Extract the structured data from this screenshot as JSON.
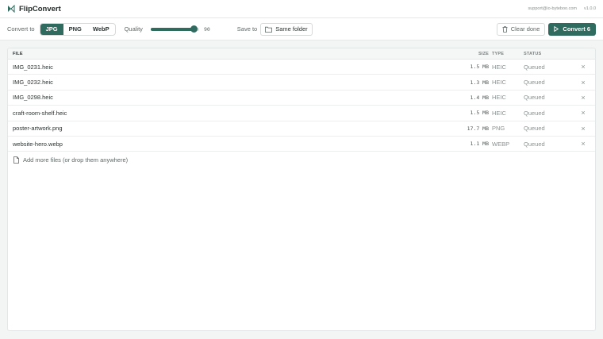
{
  "app": {
    "title": "FlipConvert",
    "support": "support@io-byteboo.com",
    "version": "v1.0.0",
    "accent": "#2f6b5f"
  },
  "toolbar": {
    "convert_to_label": "Convert to",
    "formats": [
      "JPG",
      "PNG",
      "WebP"
    ],
    "selected_format": "JPG",
    "quality_label": "Quality",
    "quality_value": "90",
    "quality_fraction": 0.9,
    "save_to_label": "Save to",
    "save_to_value": "Same folder",
    "clear_label": "Clear done",
    "convert_label": "Convert 6"
  },
  "table": {
    "headers": {
      "file": "FILE",
      "size": "SIZE",
      "type": "TYPE",
      "status": "STATUS"
    },
    "rows": [
      {
        "file": "IMG_0231.heic",
        "size": "1.5 MB",
        "type": "HEIC",
        "status": "Queued"
      },
      {
        "file": "IMG_0232.heic",
        "size": "1.3 MB",
        "type": "HEIC",
        "status": "Queued"
      },
      {
        "file": "IMG_0298.heic",
        "size": "1.4 MB",
        "type": "HEIC",
        "status": "Queued"
      },
      {
        "file": "craft-room-shelf.heic",
        "size": "1.5 MB",
        "type": "HEIC",
        "status": "Queued"
      },
      {
        "file": "poster-artwork.png",
        "size": "17.7 MB",
        "type": "PNG",
        "status": "Queued"
      },
      {
        "file": "website-hero.webp",
        "size": "1.1 MB",
        "type": "WEBP",
        "status": "Queued"
      }
    ],
    "remove_glyph": "×",
    "add_more": "Add more files (or drop them anywhere)"
  },
  "icons": {
    "logo": "flip-logo-icon",
    "trash": "trash-icon",
    "play": "play-icon",
    "folder": "folder-icon",
    "file": "file-icon"
  }
}
